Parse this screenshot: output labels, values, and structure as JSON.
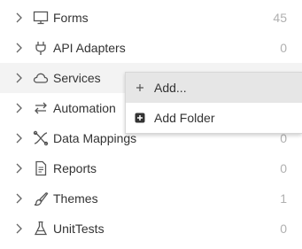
{
  "tree": {
    "items": [
      {
        "label": "Forms",
        "count": "45",
        "icon": "monitor-icon"
      },
      {
        "label": "API Adapters",
        "count": "0",
        "icon": "plug-icon"
      },
      {
        "label": "Services",
        "count": "",
        "icon": "cloud-icon"
      },
      {
        "label": "Automation",
        "count": "",
        "icon": "arrows-swap-icon"
      },
      {
        "label": "Data Mappings",
        "count": "0",
        "icon": "mapping-icon"
      },
      {
        "label": "Reports",
        "count": "0",
        "icon": "document-icon"
      },
      {
        "label": "Themes",
        "count": "1",
        "icon": "brush-icon"
      },
      {
        "label": "UnitTests",
        "count": "0",
        "icon": "flask-icon"
      }
    ]
  },
  "context_menu": {
    "items": [
      {
        "label": "Add...",
        "icon": "plus-icon"
      },
      {
        "label": "Add Folder",
        "icon": "add-folder-icon"
      }
    ]
  },
  "colors": {
    "text": "#333333",
    "count": "#b0b0b0",
    "hover_row": "#f3f3f3",
    "menu_active": "#e6e6e6"
  }
}
